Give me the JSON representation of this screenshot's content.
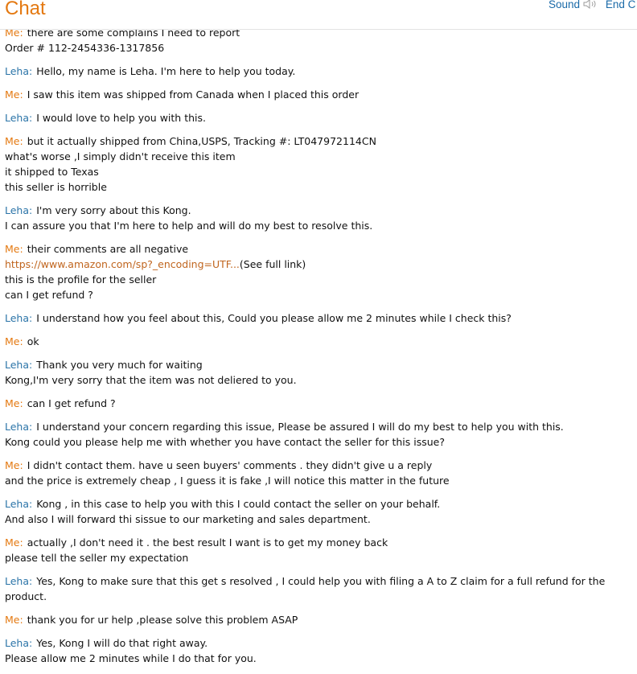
{
  "header": {
    "title": "Chat",
    "sound_label": "Sound",
    "sound_icon": "speaker-icon",
    "end_label": "End C"
  },
  "messages": [
    {
      "speaker": "Me:",
      "lines": [
        "there are some complains I need to report",
        "Order # 112-2454336-1317856"
      ]
    },
    {
      "speaker": "Leha:",
      "lines": [
        "Hello, my name is Leha. I'm here to help you today."
      ]
    },
    {
      "speaker": "Me:",
      "lines": [
        "I saw this item was shipped from Canada when I placed this order"
      ]
    },
    {
      "speaker": "Leha:",
      "lines": [
        "I would love to help you with this."
      ]
    },
    {
      "speaker": "Me:",
      "lines": [
        "but it actually shipped from China,USPS, Tracking #: LT047972114CN",
        "what's worse ,I simply didn't receive this item",
        "it shipped to Texas",
        "this seller is horrible"
      ]
    },
    {
      "speaker": "Leha:",
      "lines": [
        "I'm very sorry about this Kong.",
        "I can assure you that I'm here to help and will do my best to resolve this."
      ]
    },
    {
      "speaker": "Me:",
      "lines": [
        "their comments are all negative",
        "",
        "this is the profile for the seller",
        "can I get refund ?"
      ],
      "link_text": "https://www.amazon.com/sp?_encoding=UTF...",
      "see_full": "(See full link)"
    },
    {
      "speaker": "Leha:",
      "lines": [
        "I understand how you feel about this, Could you please allow me 2 minutes while I check this?"
      ]
    },
    {
      "speaker": "Me:",
      "lines": [
        "ok"
      ]
    },
    {
      "speaker": "Leha:",
      "lines": [
        "Thank you very much for waiting",
        "Kong,I'm very sorry that the item was not deliered to you."
      ]
    },
    {
      "speaker": "Me:",
      "lines": [
        "can I get refund ?"
      ]
    },
    {
      "speaker": "Leha:",
      "lines": [
        "I understand your concern regarding this issue, Please be assured I will do my best to help you with this.",
        "Kong could you please help me with whether you have contact the seller for this issue?"
      ]
    },
    {
      "speaker": "Me:",
      "lines": [
        "I didn't contact them. have u seen buyers' comments . they didn't give u a reply",
        "and the price is extremely cheap , I guess it is fake ,I will notice this matter in the future"
      ]
    },
    {
      "speaker": "Leha:",
      "lines": [
        "Kong , in this case to help you with this I could contact the seller on your behalf.",
        "And also I will forward thi sissue to our marketing and sales department."
      ]
    },
    {
      "speaker": "Me:",
      "lines": [
        "actually ,I don't need it . the best result I want is to get my money back",
        "please tell the seller my expectation"
      ]
    },
    {
      "speaker": "Leha:",
      "lines": [
        "Yes, Kong to make sure that this get s resolved , I could help you with filing a A to Z claim for a full refund for the product."
      ]
    },
    {
      "speaker": "Me:",
      "lines": [
        "thank you for ur help ,please solve this problem ASAP"
      ]
    },
    {
      "speaker": "Leha:",
      "lines": [
        "Yes, Kong I will do that right away.",
        "Please allow me 2 minutes while I do that for you."
      ]
    }
  ]
}
